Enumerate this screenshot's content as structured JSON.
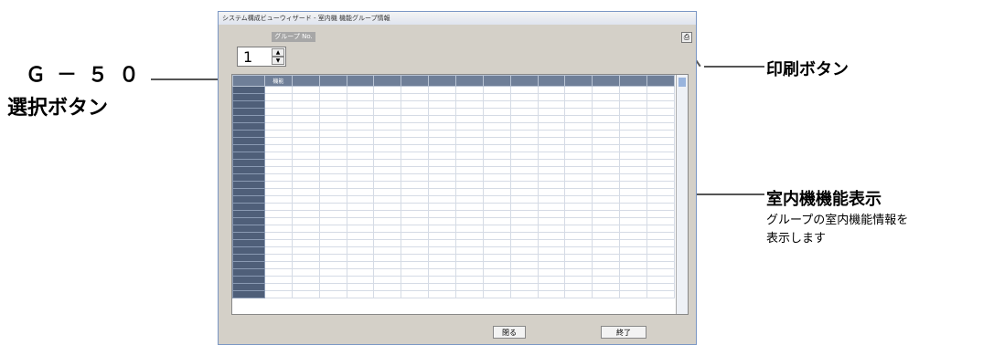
{
  "callouts": {
    "g50_label_line1": "Ｇ－５０",
    "g50_label_line2": "選択ボタン",
    "print": "印刷ボタン",
    "indoor_title": "室内機機能表示",
    "indoor_desc_line1": "グループの室内機能情報を",
    "indoor_desc_line2": "表示します"
  },
  "window": {
    "title": "システム構成ビューウィザード - 室内機 機能グループ情報",
    "tab_label": "グループ No.",
    "spinner_value": "1",
    "buttons": {
      "close": "閉る",
      "exit": "終了"
    }
  },
  "table": {
    "headers": [
      "",
      "機能",
      "",
      "",
      "",
      "",
      "",
      "",
      "",
      "",
      "",
      "",
      "",
      "",
      "",
      ""
    ],
    "rows": [
      [
        "",
        "",
        "",
        "",
        "",
        "",
        "",
        "",
        "",
        "",
        "",
        "",
        "",
        "",
        "",
        ""
      ]
    ]
  }
}
